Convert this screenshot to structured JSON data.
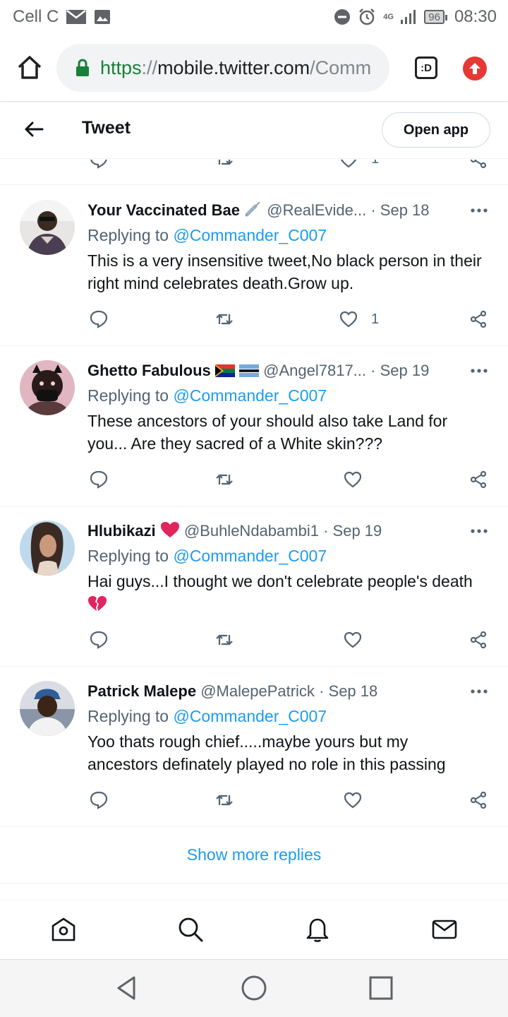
{
  "status_bar": {
    "carrier": "Cell C",
    "network": "4G",
    "battery": "96",
    "time": "08:30"
  },
  "browser": {
    "url_scheme": "https",
    "url_separator": "://",
    "url_host": "mobile.twitter.com",
    "url_rest": "/Comm",
    "tab_switcher_label": ":D"
  },
  "header": {
    "title": "Tweet",
    "open_app_label": "Open app"
  },
  "replying_prefix": "Replying to",
  "tweets": [
    {
      "name": "Your Vaccinated Bae",
      "handle": "@RealEvide...",
      "dot": "·",
      "date": "Sep 18",
      "replying_to": "@Commander_C007",
      "text": "This is a very insensitive tweet,No black person in their right mind celebrates death.Grow up.",
      "like_count": "1"
    },
    {
      "name": "Ghetto Fabulous",
      "handle": "@Angel7817...",
      "dot": "·",
      "date": "Sep 19",
      "replying_to": "@Commander_C007",
      "text": "These ancestors of your should also take Land for you... Are they sacred of a White skin???",
      "like_count": ""
    },
    {
      "name": "Hlubikazi",
      "handle": "@BuhleNdabambi1",
      "dot": "·",
      "date": "Sep 19",
      "replying_to": "@Commander_C007",
      "text": "Hai guys...I thought we don't celebrate people's death",
      "like_count": ""
    },
    {
      "name": "Patrick Malepe",
      "handle": "@MalepePatrick",
      "dot": "·",
      "date": "Sep 18",
      "replying_to": "@Commander_C007",
      "text": "Yoo thats rough chief.....maybe yours but my ancestors definately played no role in this passing",
      "like_count": ""
    }
  ],
  "show_more_label": "Show more replies",
  "previous_tweet": {
    "like_count": "1"
  },
  "colors": {
    "link_blue": "#1d9bf0",
    "secondary_text": "#536471",
    "primary_text": "#0f1419",
    "url_green": "#188038",
    "update_red": "#e53935"
  },
  "icons": {
    "bottom_nav": [
      "home-icon",
      "search-icon",
      "notifications-icon",
      "messages-icon"
    ],
    "system_nav": [
      "back-triangle-icon",
      "home-circle-icon",
      "recents-square-icon"
    ]
  }
}
